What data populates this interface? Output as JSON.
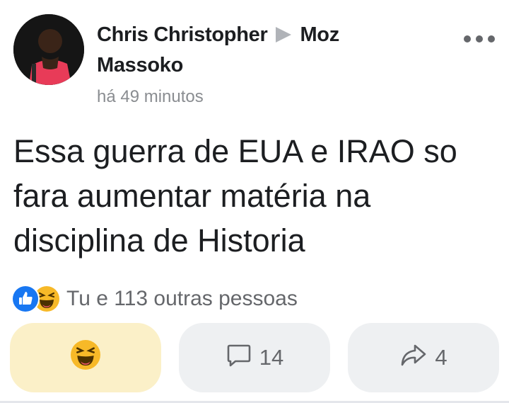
{
  "post": {
    "author": "Chris Christopher",
    "group": "Moz Massoko",
    "time": "há 49 minutos",
    "text": "Essa guerra de EUA e IRAO so fara aumentar matéria na disciplina de Historia"
  },
  "reactions": {
    "icons": [
      "like-icon",
      "haha-icon"
    ],
    "summary": "Tu e 113 outras pessoas"
  },
  "actions": {
    "react_icon": "haha-icon",
    "comments_count": "14",
    "shares_count": "4"
  },
  "colors": {
    "like_blue": "#1877f2",
    "haha_yellow": "#f7b928",
    "react_button_bg": "#fbf0c8",
    "button_bg": "#eef0f2",
    "secondary_text": "#65676b"
  }
}
